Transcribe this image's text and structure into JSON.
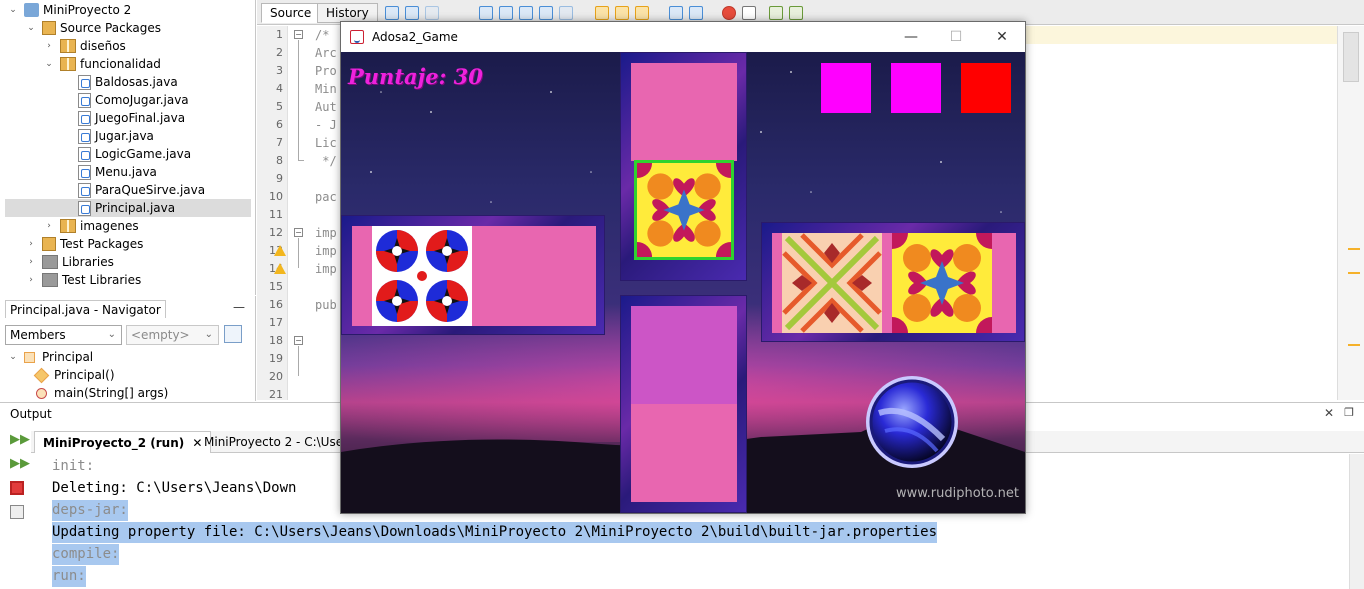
{
  "project_tree": {
    "items": [
      {
        "label": "MiniProyecto 2",
        "level": 0,
        "icon": "project-icon",
        "expanded": true
      },
      {
        "label": "Source Packages",
        "level": 1,
        "icon": "source-packages-icon",
        "expanded": true
      },
      {
        "label": "diseños",
        "level": 2,
        "icon": "package-icon",
        "expanded": false
      },
      {
        "label": "funcionalidad",
        "level": 2,
        "icon": "package-icon",
        "expanded": true
      },
      {
        "label": "Baldosas.java",
        "level": 3,
        "icon": "java-file-icon"
      },
      {
        "label": "ComoJugar.java",
        "level": 3,
        "icon": "java-file-icon"
      },
      {
        "label": "JuegoFinal.java",
        "level": 3,
        "icon": "java-file-icon"
      },
      {
        "label": "Jugar.java",
        "level": 3,
        "icon": "java-file-icon"
      },
      {
        "label": "LogicGame.java",
        "level": 3,
        "icon": "java-file-icon"
      },
      {
        "label": "Menu.java",
        "level": 3,
        "icon": "java-file-icon"
      },
      {
        "label": "ParaQueSirve.java",
        "level": 3,
        "icon": "java-file-icon"
      },
      {
        "label": "Principal.java",
        "level": 3,
        "icon": "java-file-icon",
        "selected": true
      },
      {
        "label": "imagenes",
        "level": 2,
        "icon": "package-icon",
        "expanded": false
      },
      {
        "label": "Test Packages",
        "level": 1,
        "icon": "test-packages-icon",
        "expanded": false
      },
      {
        "label": "Libraries",
        "level": 1,
        "icon": "libraries-icon",
        "expanded": false
      },
      {
        "label": "Test Libraries",
        "level": 1,
        "icon": "libraries-icon",
        "expanded": false
      }
    ]
  },
  "navigator": {
    "title": "Principal.java - Navigator",
    "minimize": "—",
    "filter": "Members",
    "filter2": "<empty>",
    "items": [
      {
        "label": "Principal",
        "level": 0
      },
      {
        "label": "Principal()",
        "level": 1
      },
      {
        "label": "main(String[] args)",
        "level": 1
      }
    ]
  },
  "editor": {
    "tabs": [
      "Source",
      "History"
    ],
    "line_numbers": [
      "1",
      "2",
      "3",
      "4",
      "5",
      "6",
      "7",
      "8",
      "9",
      "10",
      "11",
      "12",
      "13",
      "14",
      "15",
      "16",
      "17",
      "18",
      "19",
      "20",
      "21"
    ],
    "lines": [
      "/*",
      "Arc",
      "Pro",
      "Min",
      "Aut",
      "- J",
      "Lic",
      " */",
      "",
      "pac",
      "",
      "imp",
      "imp",
      "imp",
      "",
      "pub",
      "",
      "",
      "",
      "",
      ""
    ]
  },
  "output": {
    "title": "Output",
    "close": "✕",
    "tabs": [
      {
        "label": "MiniProyecto_2 (run)",
        "close": "✕"
      },
      {
        "label": "MiniProyecto 2 - C:\\Users"
      }
    ],
    "lines": [
      {
        "text": "init:",
        "style": "grey"
      },
      {
        "text": "Deleting: C:\\Users\\Jeans\\Down",
        "style": "plain"
      },
      {
        "text": "deps-jar:",
        "style": "grey-sel"
      },
      {
        "text": "Updating property file: C:\\Users\\Jeans\\Downloads\\MiniProyecto 2\\MiniProyecto 2\\build\\built-jar.properties",
        "style": "sel"
      },
      {
        "text": "compile:",
        "style": "grey-sel"
      },
      {
        "text": "run:",
        "style": "grey-sel"
      }
    ]
  },
  "game_window": {
    "title": "Adosa2_Game",
    "controls": {
      "minimize": "—",
      "maximize": "☐",
      "close": "✕"
    },
    "score": "Puntaje: 30",
    "indicator_colors": [
      "#ff00ff",
      "#ff00ff",
      "#ff0000"
    ],
    "watermark": "www.rudiphoto.net"
  }
}
